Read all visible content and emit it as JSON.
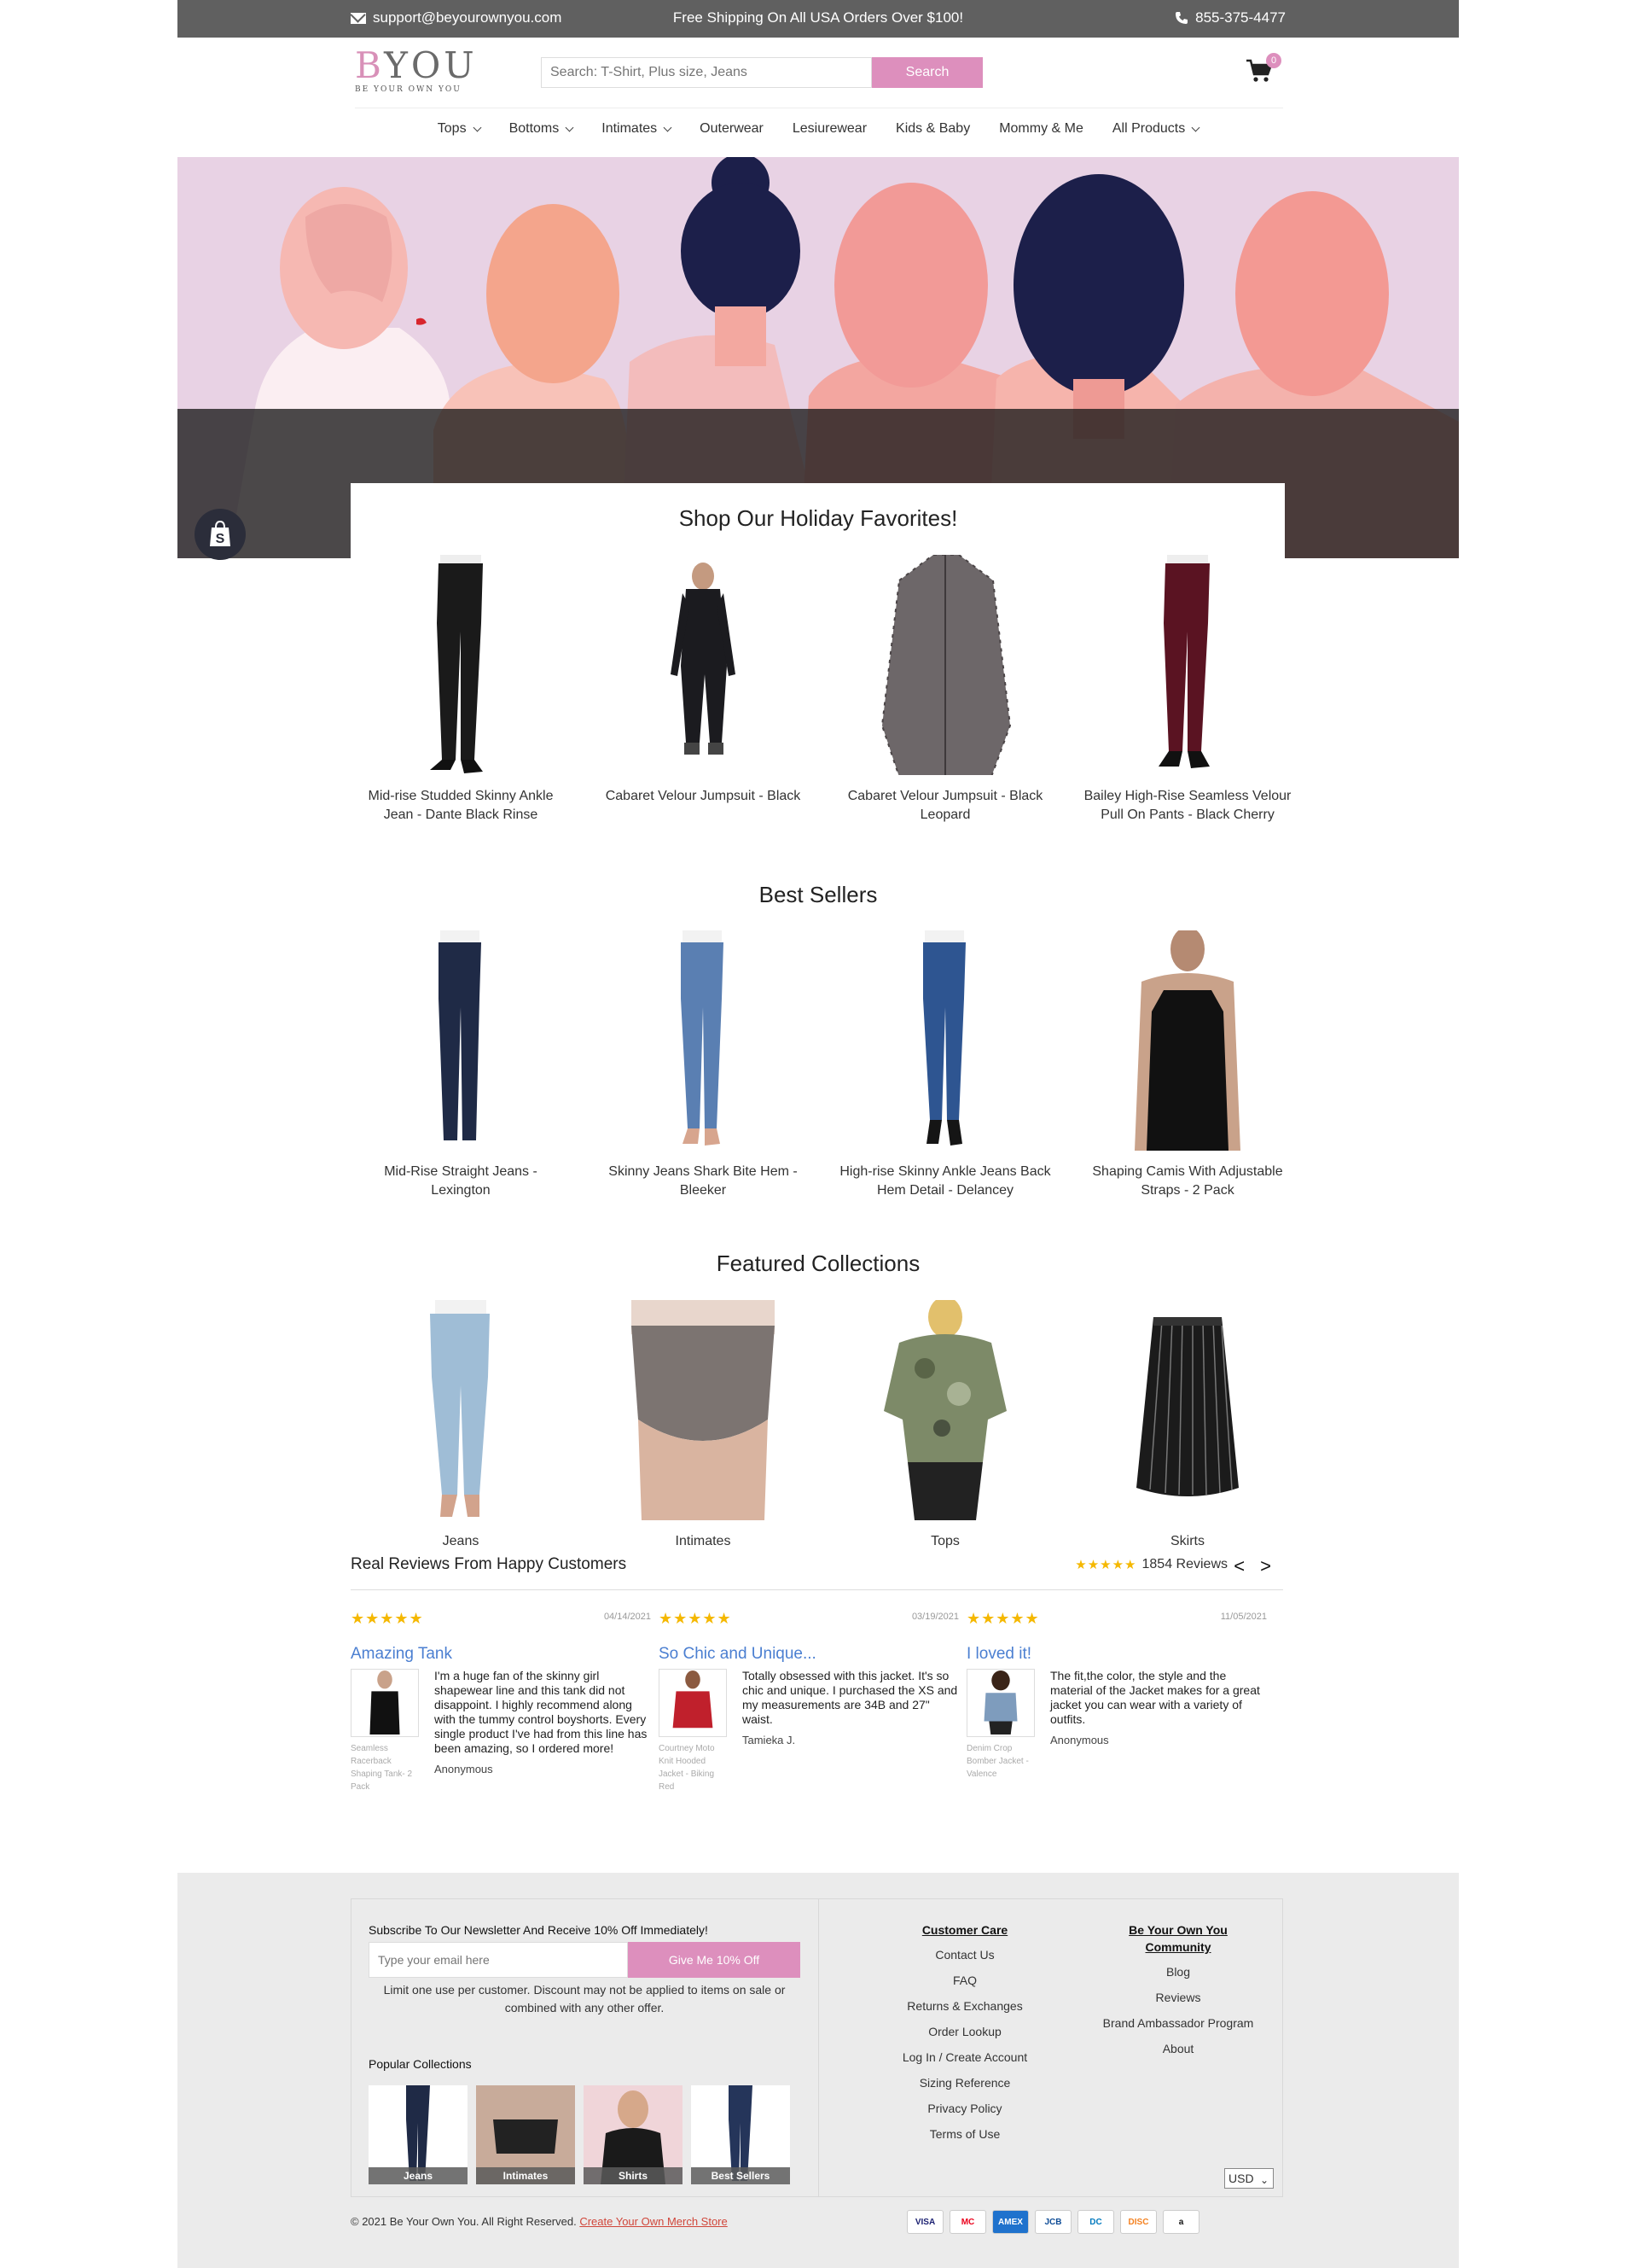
{
  "topbar": {
    "email": "support@beyourownyou.com",
    "promo": "Free Shipping On All USA Orders Over $100!",
    "phone": "855-375-4477"
  },
  "logo": {
    "main": "BYOU",
    "tagline": "BE YOUR OWN YOU"
  },
  "search": {
    "placeholder": "Search: T-Shirt, Plus size, Jeans",
    "button": "Search"
  },
  "cart": {
    "count": "0"
  },
  "nav": [
    {
      "label": "Tops",
      "dropdown": true
    },
    {
      "label": "Bottoms",
      "dropdown": true
    },
    {
      "label": "Intimates",
      "dropdown": true
    },
    {
      "label": "Outerwear",
      "dropdown": false
    },
    {
      "label": "Lesiurewear",
      "dropdown": false
    },
    {
      "label": "Kids & Baby",
      "dropdown": false
    },
    {
      "label": "Mommy & Me",
      "dropdown": false
    },
    {
      "label": "All Products",
      "dropdown": true
    }
  ],
  "holiday": {
    "title": "Shop Our Holiday Favorites!",
    "items": [
      {
        "name": "Mid-rise Studded Skinny Ankle Jean - Dante Black Rinse"
      },
      {
        "name": "Cabaret Velour Jumpsuit - Black"
      },
      {
        "name": "Cabaret Velour Jumpsuit - Black Leopard"
      },
      {
        "name": "Bailey High-Rise Seamless Velour Pull On Pants - Black Cherry"
      }
    ]
  },
  "bestsellers": {
    "title": "Best Sellers",
    "items": [
      {
        "name": "Mid-Rise Straight Jeans - Lexington"
      },
      {
        "name": "Skinny Jeans Shark Bite Hem - Bleeker"
      },
      {
        "name": "High-rise Skinny Ankle Jeans Back Hem Detail - Delancey"
      },
      {
        "name": "Shaping Camis With Adjustable Straps - 2 Pack"
      }
    ]
  },
  "collections": {
    "title": "Featured Collections",
    "items": [
      {
        "name": "Jeans"
      },
      {
        "name": "Intimates"
      },
      {
        "name": "Tops"
      },
      {
        "name": "Skirts"
      }
    ]
  },
  "reviews": {
    "title": "Real Reviews From Happy Customers",
    "stars": "★★★★★",
    "count": "1854 Reviews",
    "prev": "<",
    "next": ">",
    "items": [
      {
        "stars": "★★★★★",
        "date": "04/14/2021",
        "title": "Amazing Tank",
        "text": "I'm a huge fan of the skinny girl shapewear line and this tank did not disappoint. I highly recommend along with the tummy control boyshorts. Every single product I've had from this line has been amazing, so I ordered more!",
        "author": "Anonymous",
        "product": "Seamless Racerback Shaping Tank- 2 Pack"
      },
      {
        "stars": "★★★★★",
        "date": "03/19/2021",
        "title": "So Chic and Unique...",
        "text": "Totally obsessed with this jacket. It's so chic and unique. I purchased the XS and my measurements are 34B and 27\" waist.",
        "author": "Tamieka J.",
        "product": "Courtney Moto Knit Hooded Jacket - Biking Red"
      },
      {
        "stars": "★★★★★",
        "date": "11/05/2021",
        "title": "I loved it!",
        "text": "The fit,the color, the style and the material of the Jacket makes for a great jacket you can wear with a variety of outfits.",
        "author": "Anonymous",
        "product": "Denim Crop Bomber Jacket - Valence"
      }
    ]
  },
  "footer": {
    "newsletter": {
      "title": "Subscribe To Our Newsletter And Receive 10% Off Immediately!",
      "placeholder": "Type your email here",
      "button": "Give Me 10% Off",
      "note": "Limit one use per customer. Discount may not be applied to items on sale or combined with any other offer."
    },
    "popular_title": "Popular Collections",
    "popular": [
      {
        "label": "Jeans"
      },
      {
        "label": "Intimates"
      },
      {
        "label": "Shirts"
      },
      {
        "label": "Best Sellers"
      }
    ],
    "care": {
      "title": "Customer Care",
      "links": [
        "Contact Us",
        "FAQ",
        "Returns & Exchanges",
        "Order Lookup",
        "Log In / Create Account",
        "Sizing Reference",
        "Privacy Policy",
        "Terms of Use"
      ]
    },
    "community": {
      "title_line1": "Be Your Own You",
      "title_line2": "Community",
      "links": [
        "Blog",
        "Reviews",
        "Brand Ambassador Program",
        "About"
      ]
    },
    "currency": "USD",
    "copyright": "© 2021 Be Your Own You. All Right Reserved.",
    "merch_link": "Create Your Own Merch Store",
    "payments": [
      "VISA",
      "MC",
      "AMEX",
      "JCB",
      "DC",
      "DISC",
      "a"
    ]
  },
  "colors": {
    "accent": "#dd8fbd",
    "topbar": "#606060",
    "review_title": "#4b7fd1",
    "stars": "#f5b800"
  }
}
